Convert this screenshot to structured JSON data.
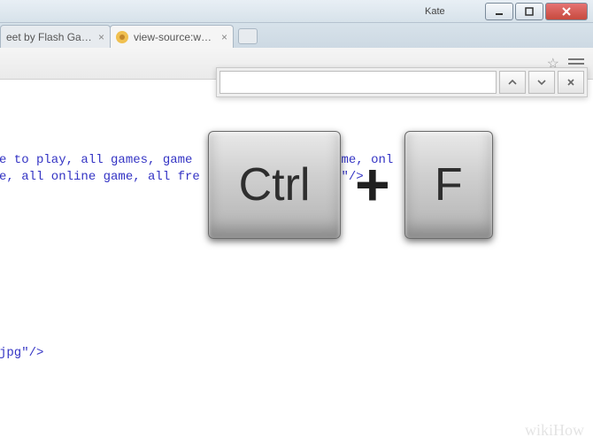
{
  "window": {
    "user_label": "Kate"
  },
  "tabs": {
    "t1": {
      "title": "eet by Flash Ga…"
    },
    "t2": {
      "title": "view-source:www.flash-g…"
    }
  },
  "findbar": {
    "value": "",
    "placeholder": ""
  },
  "source": {
    "line1": "e to play, all games, game              ash game, onl        me,",
    "line2": "e, all online game, all fre             e game\"/>",
    "line3": "jpg\"/>"
  },
  "keys": {
    "ctrl": "Ctrl",
    "plus": "+",
    "f": "F"
  },
  "watermark": "wikiHow"
}
